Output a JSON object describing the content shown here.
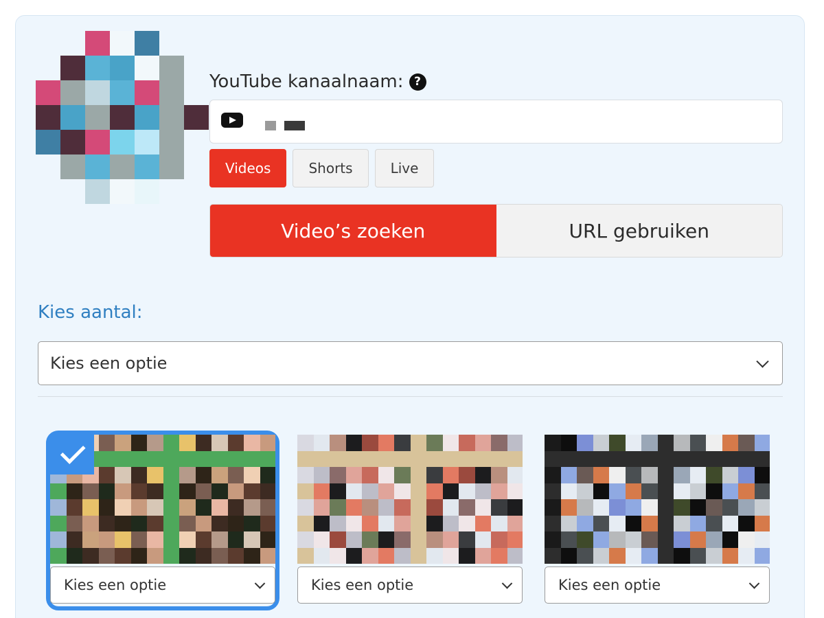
{
  "channel": {
    "label": "YouTube kanaalnaam:",
    "help_icon": "question-circle-icon",
    "input_icon": "youtube-play-icon"
  },
  "content_types": [
    {
      "label": "Videos",
      "active": true
    },
    {
      "label": "Shorts",
      "active": false
    },
    {
      "label": "Live",
      "active": false
    }
  ],
  "modes": [
    {
      "label": "Video’s zoeken",
      "active": true
    },
    {
      "label": "URL gebruiken",
      "active": false
    }
  ],
  "count": {
    "label": "Kies aantal:",
    "selected": "Kies een optie"
  },
  "videos": [
    {
      "selected": true,
      "option": "Kies een optie"
    },
    {
      "selected": false,
      "option": "Kies een optie"
    },
    {
      "selected": false,
      "option": "Kies een optie"
    }
  ],
  "colors": {
    "accent_red": "#e93323",
    "accent_blue": "#3b8eea",
    "label_blue": "#2f7fc1",
    "panel_bg": "#eef6fd"
  }
}
